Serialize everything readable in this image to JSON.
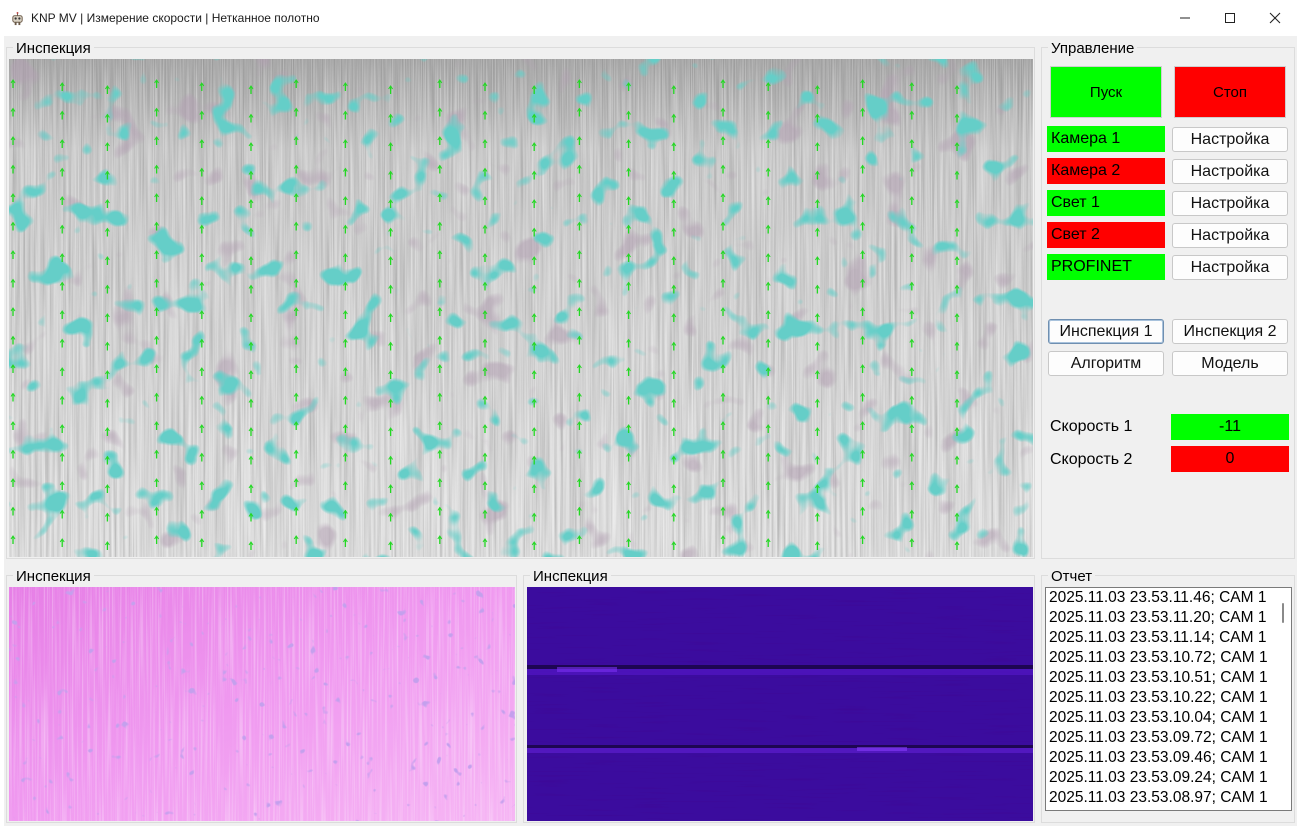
{
  "window": {
    "title": "KNP MV | Измерение скорости | Нетканное полотно",
    "app_icon": "robot-icon",
    "controls": [
      "minimize-icon",
      "maximize-icon",
      "close-icon"
    ]
  },
  "inspection_main": {
    "title": "Инспекция",
    "image": "grayscale nonwoven fabric texture with teal detection blobs and green upward motion arrows"
  },
  "inspection_bottom_left": {
    "title": "Инспекция",
    "image": "pink/magenta fabric texture"
  },
  "inspection_bottom_right": {
    "title": "Инспекция",
    "image": "dark violet fabric texture with horizontal bands"
  },
  "control": {
    "title": "Управление",
    "start_label": "Пуск",
    "stop_label": "Стоп",
    "devices": [
      {
        "name": "Камера 1",
        "status": "ok",
        "setup_label": "Настройка"
      },
      {
        "name": "Камера 2",
        "status": "error",
        "setup_label": "Настройка"
      },
      {
        "name": "Свет 1",
        "status": "ok",
        "setup_label": "Настройка"
      },
      {
        "name": "Свет 2",
        "status": "error",
        "setup_label": "Настройка"
      },
      {
        "name": "PROFINET",
        "status": "ok",
        "setup_label": "Настройка"
      }
    ],
    "view_buttons": {
      "inspection1": "Инспекция 1",
      "inspection2": "Инспекция 2",
      "algorithm": "Алгоритм",
      "model": "Модель"
    },
    "speeds": [
      {
        "label": "Скорость 1",
        "value": "-11",
        "status": "ok"
      },
      {
        "label": "Скорость 2",
        "value": "0",
        "status": "error"
      }
    ]
  },
  "report": {
    "title": "Отчет",
    "rows": [
      "2025.11.03 23.53.11.46; CAM 1",
      "2025.11.03 23.53.11.20; CAM 1",
      "2025.11.03 23.53.11.14; CAM 1",
      "2025.11.03 23.53.10.72; CAM 1",
      "2025.11.03 23.53.10.51; CAM 1",
      "2025.11.03 23.53.10.22; CAM 1",
      "2025.11.03 23.53.10.04; CAM 1",
      "2025.11.03 23.53.09.72; CAM 1",
      "2025.11.03 23.53.09.46; CAM 1",
      "2025.11.03 23.53.09.24; CAM 1",
      "2025.11.03 23.53.08.97; CAM 1"
    ]
  },
  "colors": {
    "ok": "#00ff00",
    "error": "#ff0000",
    "panel_bg": "#f0f0f0",
    "arrow": "#22d822",
    "blob": "#2aa89a",
    "pink_bg": "#ee8ee8",
    "violet_bg": "#3a0a9a"
  }
}
